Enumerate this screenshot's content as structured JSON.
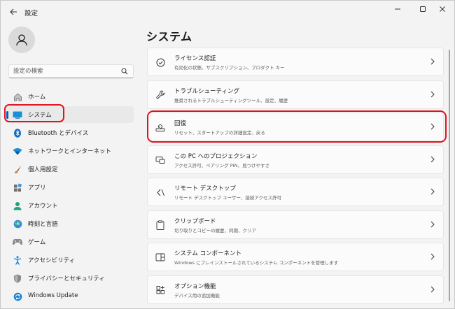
{
  "window": {
    "title": "設定"
  },
  "search": {
    "placeholder": "設定の検索"
  },
  "sidebar": {
    "items": [
      {
        "label": "ホーム",
        "icon": "home-icon",
        "active": false
      },
      {
        "label": "システム",
        "icon": "system-icon",
        "active": true
      },
      {
        "label": "Bluetooth とデバイス",
        "icon": "bluetooth-icon",
        "active": false
      },
      {
        "label": "ネットワークとインターネット",
        "icon": "network-icon",
        "active": false
      },
      {
        "label": "個人用設定",
        "icon": "personalization-icon",
        "active": false
      },
      {
        "label": "アプリ",
        "icon": "apps-icon",
        "active": false
      },
      {
        "label": "アカウント",
        "icon": "account-icon",
        "active": false
      },
      {
        "label": "時刻と言語",
        "icon": "time-language-icon",
        "active": false
      },
      {
        "label": "ゲーム",
        "icon": "gaming-icon",
        "active": false
      },
      {
        "label": "アクセシビリティ",
        "icon": "accessibility-icon",
        "active": false
      },
      {
        "label": "プライバシーとセキュリティ",
        "icon": "privacy-shield-icon",
        "active": false
      },
      {
        "label": "Windows Update",
        "icon": "windows-update-icon",
        "active": false
      }
    ]
  },
  "main": {
    "title": "システム",
    "cards": [
      {
        "title": "ライセンス認証",
        "desc": "有効化の状態、サブスクリプション、プロダクト キー",
        "icon": "activation-check-icon"
      },
      {
        "title": "トラブルシューティング",
        "desc": "推奨されるトラブルシューティングツール、設定、履歴",
        "icon": "wrench-icon"
      },
      {
        "title": "回復",
        "desc": "リセット、スタートアップの詳細設定、戻る",
        "icon": "recovery-icon"
      },
      {
        "title": "この PC へのプロジェクション",
        "desc": "アクセス許可、ペアリング PIN、見つけやすさ",
        "icon": "projection-icon"
      },
      {
        "title": "リモート デスクトップ",
        "desc": "リモート デスクトップ ユーザー、接続アクセス許可",
        "icon": "remote-desktop-icon"
      },
      {
        "title": "クリップボード",
        "desc": "切り取りとコピーの履歴、同期、クリア",
        "icon": "clipboard-icon"
      },
      {
        "title": "システム コンポーネント",
        "desc": "Windows にプレインストールされているシステム コンポーネントを管理します",
        "icon": "system-components-icon"
      },
      {
        "title": "オプション機能",
        "desc": "デバイス用の追加機能",
        "icon": "optional-features-icon"
      }
    ]
  },
  "colors": {
    "accent": "#005fb8",
    "highlight": "#e0141e",
    "background": "#f3f3f3",
    "card": "#fbfbfb"
  }
}
